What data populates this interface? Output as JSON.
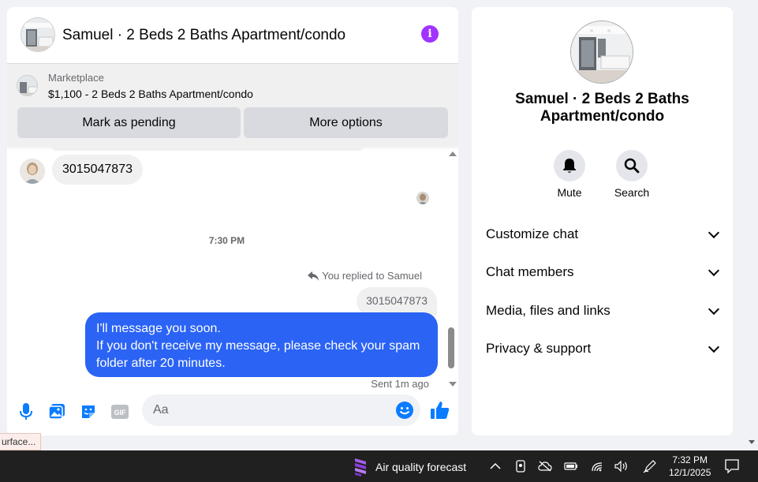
{
  "chat": {
    "title": "Samuel · 2 Beds 2 Baths Apartment/condo",
    "marketplace_label": "Marketplace",
    "listing": "$1,100 - 2 Beds 2 Baths Apartment/condo",
    "mark_pending_label": "Mark as pending",
    "more_options_label": "More options",
    "incoming_message": "3015047873",
    "timestamp": "7:30 PM",
    "reply_note": "You replied to Samuel",
    "quoted_message": "3015047873",
    "outgoing_lines": [
      "I'll message you soon.",
      "If you don't receive my message, please check your spam",
      "folder after 20 minutes."
    ],
    "sent_note": "Sent 1m ago",
    "input_placeholder": "Aa",
    "gif_label": "GIF"
  },
  "info_panel": {
    "title": "Samuel · 2 Beds 2 Baths Apartment/condo",
    "mute_label": "Mute",
    "search_label": "Search",
    "sections": [
      {
        "label": "Customize chat"
      },
      {
        "label": "Chat members"
      },
      {
        "label": "Media, files and links"
      },
      {
        "label": "Privacy & support"
      }
    ]
  },
  "status_tip": "urface...",
  "taskbar": {
    "weather_label": "Air quality forecast",
    "time": "7:32 PM",
    "date": "12/1/2025"
  },
  "colors": {
    "accent_blue": "#2b63f5",
    "info_purple": "#a033ff",
    "icon_blue": "#0a7cff"
  }
}
